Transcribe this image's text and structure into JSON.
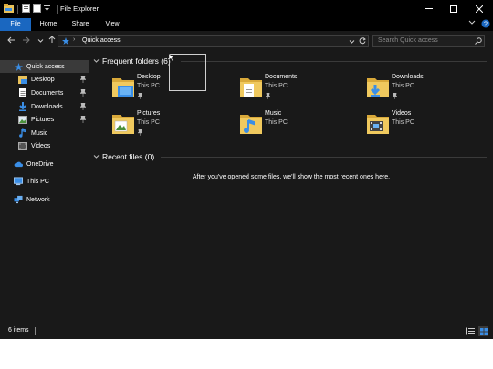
{
  "window": {
    "title": "File Explorer"
  },
  "ribbon": {
    "tabs": [
      "File",
      "Home",
      "Share",
      "View"
    ]
  },
  "address": {
    "current": "Quick access"
  },
  "search": {
    "placeholder": "Search Quick access"
  },
  "nav": {
    "quick_access": "Quick access",
    "items": [
      "Desktop",
      "Documents",
      "Downloads",
      "Pictures",
      "Music",
      "Videos"
    ],
    "onedrive": "OneDrive",
    "this_pc": "This PC",
    "network": "Network"
  },
  "content": {
    "frequent_header": "Frequent folders (6)",
    "recent_header": "Recent files (0)",
    "empty_message": "After you've opened some files, we'll show the most recent ones here.",
    "folders": [
      {
        "name": "Desktop",
        "location": "This PC",
        "pinned": true,
        "icon": "desktop-folder-icon"
      },
      {
        "name": "Documents",
        "location": "This PC",
        "pinned": true,
        "icon": "documents-folder-icon"
      },
      {
        "name": "Downloads",
        "location": "This PC",
        "pinned": true,
        "icon": "downloads-folder-icon"
      },
      {
        "name": "Pictures",
        "location": "This PC",
        "pinned": true,
        "icon": "pictures-folder-icon"
      },
      {
        "name": "Music",
        "location": "This PC",
        "pinned": false,
        "icon": "music-folder-icon"
      },
      {
        "name": "Videos",
        "location": "This PC",
        "pinned": false,
        "icon": "videos-folder-icon"
      }
    ]
  },
  "status": {
    "items_count": "6 items"
  },
  "colors": {
    "accent": "#1a67c0",
    "background": "#191919",
    "folder": "#e8c15a"
  }
}
